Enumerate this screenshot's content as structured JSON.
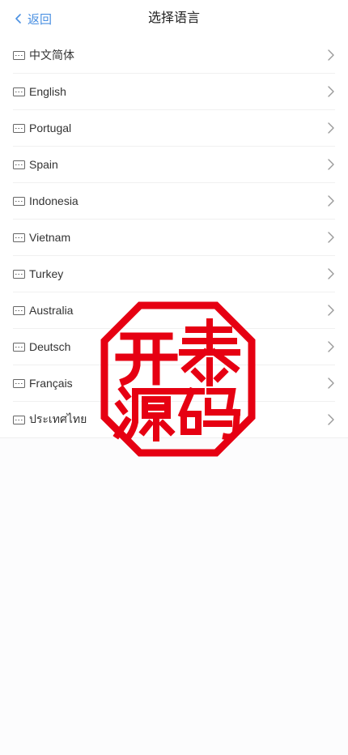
{
  "header": {
    "back_label": "返回",
    "title": "选择语言"
  },
  "languages": [
    {
      "label": "中文简体"
    },
    {
      "label": "English"
    },
    {
      "label": "Portugal"
    },
    {
      "label": "Spain"
    },
    {
      "label": "Indonesia"
    },
    {
      "label": "Vietnam"
    },
    {
      "label": "Turkey"
    },
    {
      "label": "Australia"
    },
    {
      "label": "Deutsch"
    },
    {
      "label": "Français"
    },
    {
      "label": "ประเทศไทย"
    }
  ],
  "seal": {
    "text": "开泰源码",
    "color": "#e60012"
  },
  "colors": {
    "accent": "#4a90e2",
    "text": "#333333",
    "chevron": "#999999"
  },
  "icons": {
    "back": "chevron-left-icon",
    "row": "keyboard-icon",
    "row_arrow": "chevron-right-icon"
  }
}
